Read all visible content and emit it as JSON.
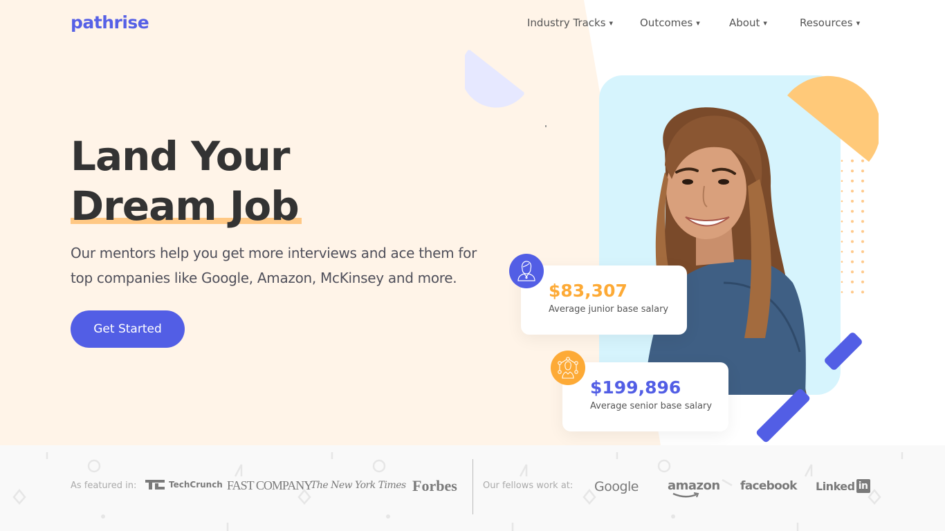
{
  "brand": {
    "logo_text": "pathrise",
    "primary_color": "#525ee5",
    "accent_color": "#fdaa36",
    "cream_bg": "#fff4e8"
  },
  "nav": {
    "items": [
      {
        "label": "Industry Tracks",
        "caret": "▾"
      },
      {
        "label": "Outcomes",
        "caret": "▾"
      },
      {
        "label": "About",
        "caret": "▾"
      },
      {
        "label": "Resources",
        "caret": "▾"
      }
    ]
  },
  "hero": {
    "headline_line1": "Land Your",
    "headline_line2": "Dream Job",
    "subtitle": "Our mentors help you get more interviews and ace them for top companies like Google, Amazon, McKinsey and more.",
    "cta_label": "Get Started"
  },
  "stats": [
    {
      "value": "$83,307",
      "label": "Average junior base salary",
      "value_color": "#fdaa36",
      "icon": "woman-profile-icon"
    },
    {
      "value": "$199,896",
      "label": "Average senior base salary",
      "value_color": "#525ee5",
      "icon": "network-person-icon"
    }
  ],
  "featured": {
    "label": "As featured in:",
    "logos": [
      {
        "name": "techcrunch",
        "text": "TechCrunch"
      },
      {
        "name": "fastcompany",
        "text": "FAST COMPANY"
      },
      {
        "name": "nyt",
        "text": "The New York Times"
      },
      {
        "name": "forbes",
        "text": "Forbes"
      }
    ]
  },
  "fellows": {
    "label": "Our fellows work at:",
    "logos": [
      {
        "name": "google",
        "text": "Google"
      },
      {
        "name": "amazon",
        "text": "amazon"
      },
      {
        "name": "facebook",
        "text": "facebook"
      },
      {
        "name": "linkedin",
        "text": "Linked",
        "badge": "in"
      }
    ]
  }
}
